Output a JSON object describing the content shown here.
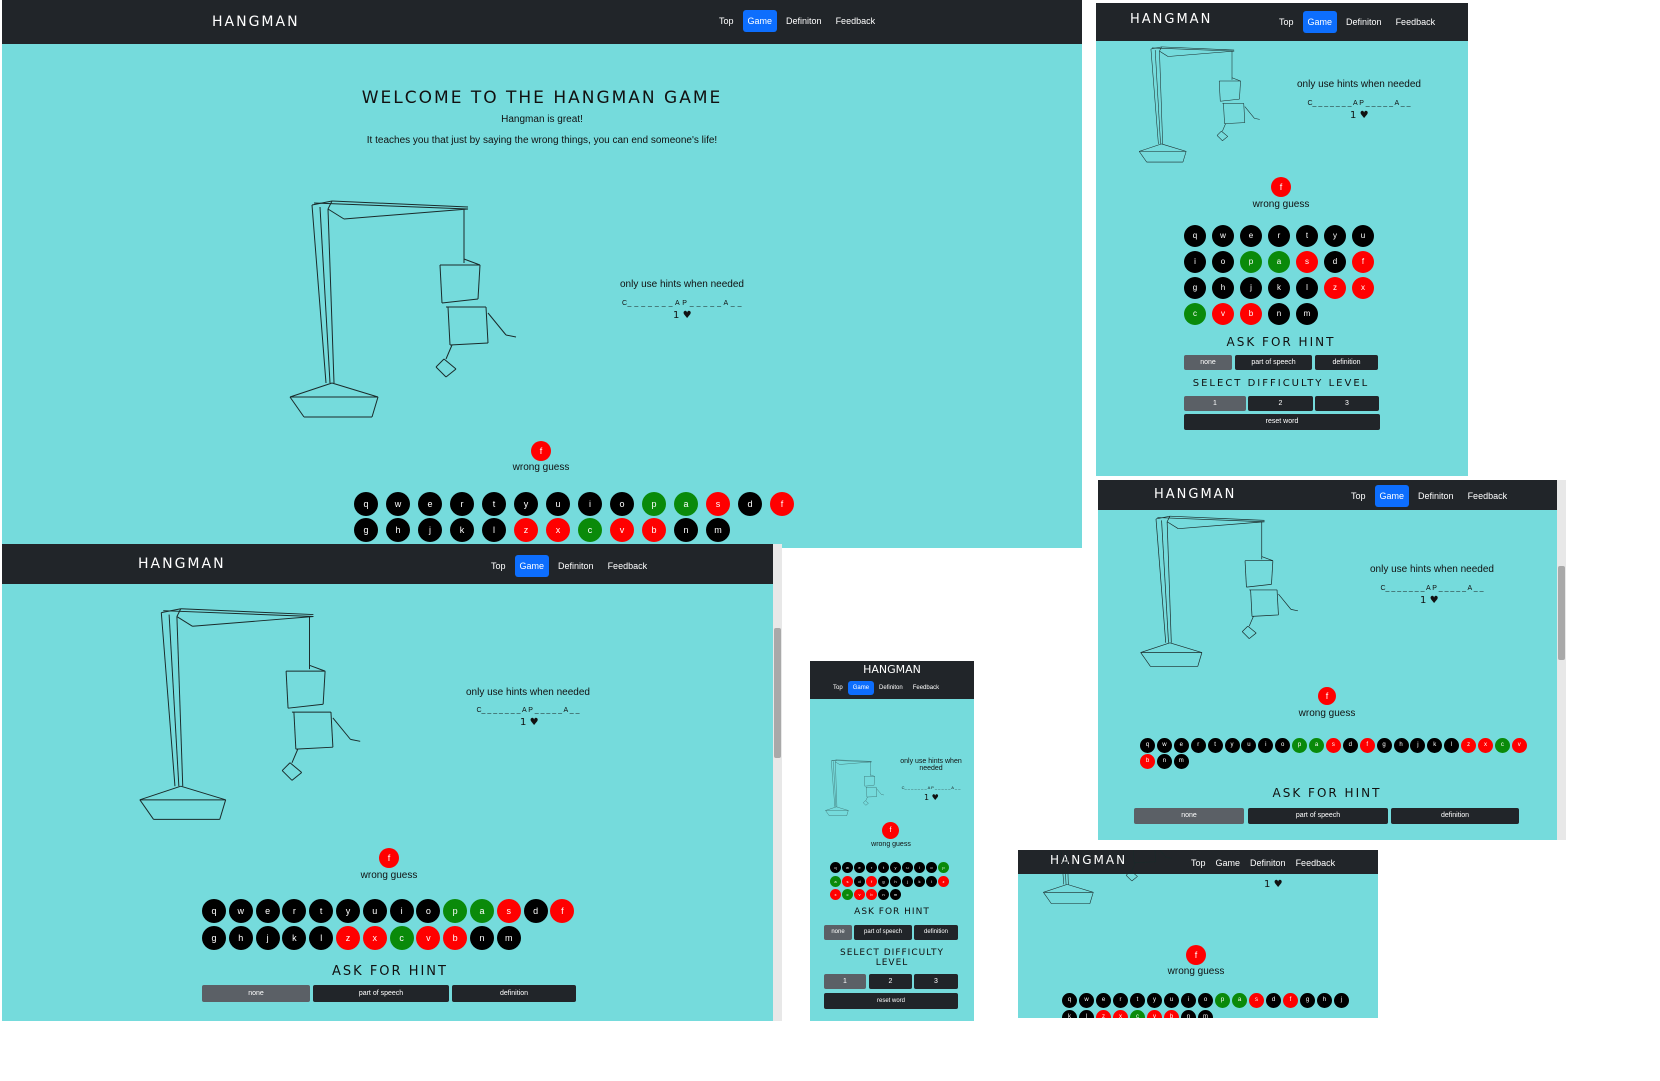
{
  "brand": "HANGMAN",
  "nav": {
    "top": "Top",
    "game": "Game",
    "definition": "Definiton",
    "feedback": "Feedback"
  },
  "welcome_title": "WELCOME TO THE HANGMAN GAME",
  "subtitle": "Hangman is great!",
  "tagline": "It teaches you that just by saying the wrong things, you can end someone's life!",
  "hint_note": "only use hints when needed",
  "word_pattern": "C_ _ _ _ _ _ _ A P _ _ _  _ _ A _ _",
  "lives": "1",
  "wrong_letter": "f",
  "wrong_label": "wrong guess",
  "ask_hint": "ASK FOR HINT",
  "hint_options": {
    "none": "none",
    "pos": "part of speech",
    "definition": "definition"
  },
  "difficulty_title": "SELECT DIFFICULTY LEVEL",
  "difficulty_levels": [
    "1",
    "2",
    "3"
  ],
  "reset": "reset word",
  "keys": [
    {
      "l": "q",
      "s": "black"
    },
    {
      "l": "w",
      "s": "black"
    },
    {
      "l": "e",
      "s": "black"
    },
    {
      "l": "r",
      "s": "black"
    },
    {
      "l": "t",
      "s": "black"
    },
    {
      "l": "y",
      "s": "black"
    },
    {
      "l": "u",
      "s": "black"
    },
    {
      "l": "i",
      "s": "black"
    },
    {
      "l": "o",
      "s": "black"
    },
    {
      "l": "p",
      "s": "green"
    },
    {
      "l": "a",
      "s": "green"
    },
    {
      "l": "s",
      "s": "red"
    },
    {
      "l": "d",
      "s": "black"
    },
    {
      "l": "f",
      "s": "red"
    },
    {
      "l": "g",
      "s": "black"
    },
    {
      "l": "h",
      "s": "black"
    },
    {
      "l": "j",
      "s": "black"
    },
    {
      "l": "k",
      "s": "black"
    },
    {
      "l": "l",
      "s": "black"
    },
    {
      "l": "z",
      "s": "red"
    },
    {
      "l": "x",
      "s": "red"
    },
    {
      "l": "c",
      "s": "green"
    },
    {
      "l": "v",
      "s": "red"
    },
    {
      "l": "b",
      "s": "red"
    },
    {
      "l": "n",
      "s": "black"
    },
    {
      "l": "m",
      "s": "black"
    }
  ],
  "colors": {
    "background": "#75dbdc",
    "navbar": "#212529",
    "active_tab": "#0d6efd",
    "wrong": "#ff0000",
    "right": "#0a8a0a",
    "unused": "#000000"
  }
}
